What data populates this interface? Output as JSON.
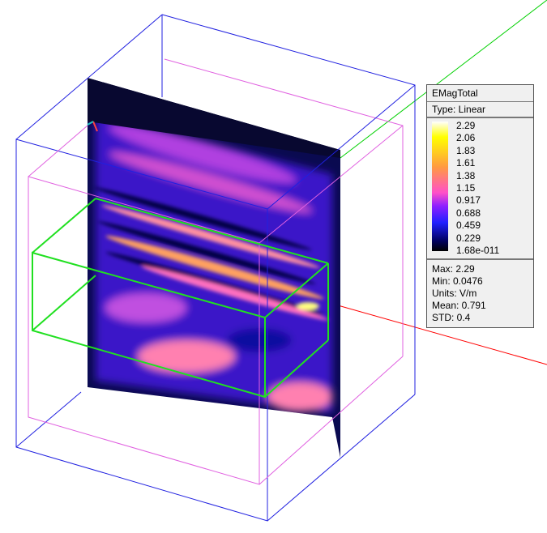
{
  "legend": {
    "title": "EMagTotal",
    "type": "Type: Linear",
    "ticks": [
      "2.29",
      "2.06",
      "1.83",
      "1.61",
      "1.38",
      "1.15",
      "0.917",
      "0.688",
      "0.459",
      "0.229",
      "1.68e-011"
    ],
    "stats": {
      "max": "Max: 2.29",
      "min": "Min: 0.0476",
      "units": "Units: V/m",
      "mean": "Mean: 0.791",
      "std": "STD: 0.4"
    },
    "colormap": [
      "#ffffff",
      "#ffff00",
      "#ff9a40",
      "#ff50c8",
      "#9020ff",
      "#2020ff",
      "#000060",
      "#000000"
    ]
  },
  "colors": {
    "outer_box": "#2020e0",
    "inner_box": "#e060e0",
    "port_box": "#20e020",
    "axis_x": "#ff0000",
    "axis_y": "#00d000"
  }
}
